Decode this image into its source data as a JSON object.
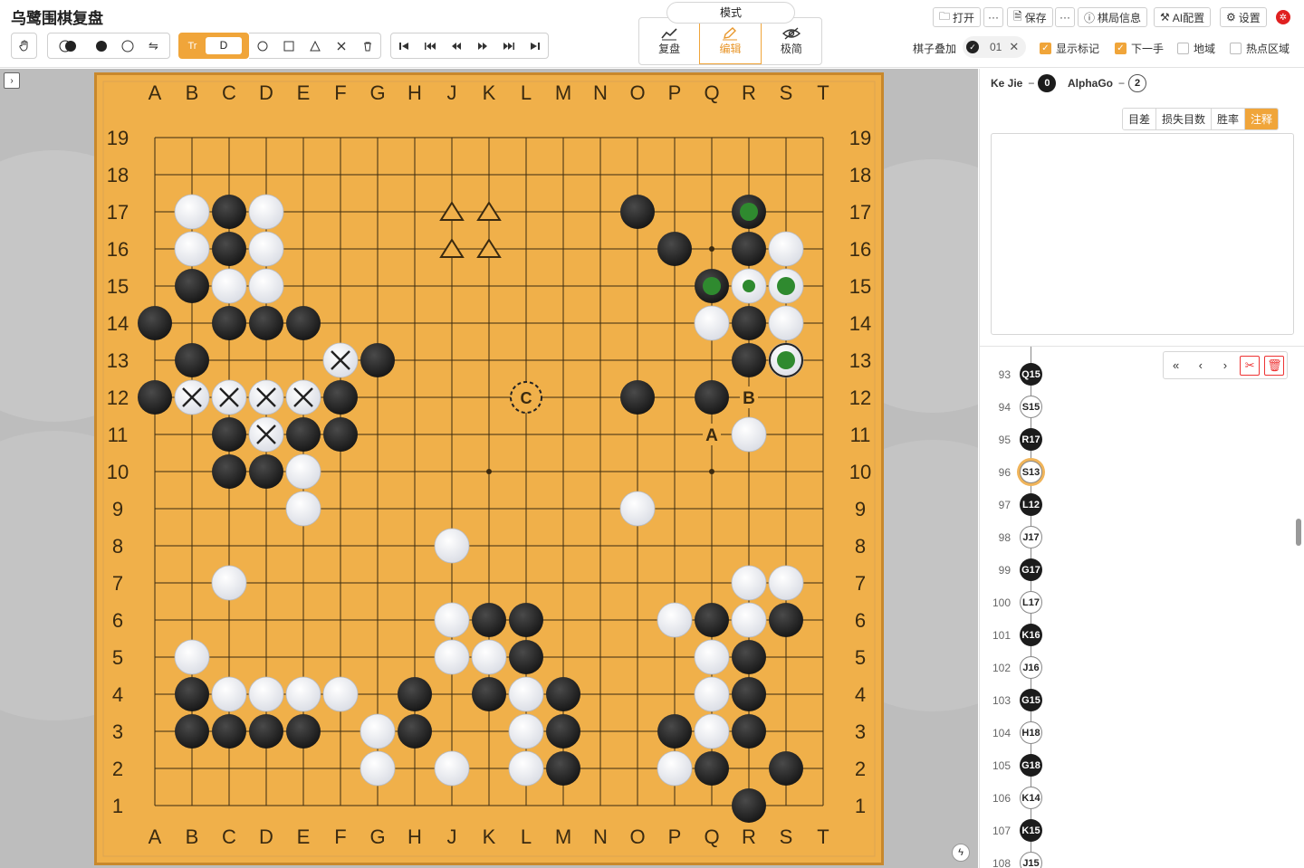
{
  "app_title": "乌鹭围棋复盘",
  "toolbar": {
    "text_input_value": "D",
    "text_tool_icon": "Tr"
  },
  "mode": {
    "title": "模式",
    "items": [
      {
        "label": "复盘"
      },
      {
        "label": "编辑"
      },
      {
        "label": "极简"
      }
    ],
    "active": "编辑"
  },
  "top_right": {
    "open": "打开",
    "save": "保存",
    "more": "···",
    "game_info": "棋局信息",
    "ai_config": "AI配置",
    "settings": "设置"
  },
  "overlay": {
    "label": "棋子叠加",
    "value": "01"
  },
  "checkboxes": [
    {
      "label": "显示标记",
      "checked": true
    },
    {
      "label": "下一手",
      "checked": true
    },
    {
      "label": "地域",
      "checked": false
    },
    {
      "label": "热点区域",
      "checked": false
    }
  ],
  "players": {
    "black": {
      "name": "Ke Jie",
      "captures": "0"
    },
    "white": {
      "name": "AlphaGo",
      "captures": "2"
    }
  },
  "analysis_tabs": [
    "目差",
    "损失目数",
    "胜率",
    "注释"
  ],
  "analysis_active": "注释",
  "board": {
    "size": 19,
    "col_labels": [
      "A",
      "B",
      "C",
      "D",
      "E",
      "F",
      "G",
      "H",
      "J",
      "K",
      "L",
      "M",
      "N",
      "O",
      "P",
      "Q",
      "R",
      "S",
      "T"
    ],
    "row_labels": [
      "19",
      "18",
      "17",
      "16",
      "15",
      "14",
      "13",
      "12",
      "11",
      "10",
      "9",
      "8",
      "7",
      "6",
      "5",
      "4",
      "3",
      "2",
      "1"
    ],
    "black_stones": [
      "C17",
      "O17",
      "R17",
      "C16",
      "P16",
      "R16",
      "B15",
      "Q15",
      "A14",
      "C14",
      "D14",
      "E14",
      "R14",
      "B13",
      "G13",
      "R13",
      "A12",
      "F12",
      "O12",
      "Q12",
      "C11",
      "E11",
      "F11",
      "C10",
      "D10",
      "K6",
      "L6",
      "Q6",
      "S6",
      "L5",
      "R5",
      "B4",
      "H4",
      "K4",
      "M4",
      "R4",
      "B3",
      "C3",
      "D3",
      "E3",
      "H3",
      "M3",
      "P3",
      "R3",
      "M2",
      "Q2",
      "S2",
      "R1"
    ],
    "white_stones": [
      "B17",
      "D17",
      "B16",
      "D16",
      "S16",
      "C15",
      "D15",
      "R15",
      "S15",
      "Q14",
      "S14",
      "S13",
      "F13",
      "B12",
      "C12",
      "D12",
      "E12",
      "D11",
      "R11",
      "E10",
      "E9",
      "O9",
      "J8",
      "C7",
      "R7",
      "S7",
      "J6",
      "P6",
      "R6",
      "B5",
      "J5",
      "K5",
      "Q5",
      "C4",
      "D4",
      "E4",
      "F4",
      "L4",
      "Q4",
      "G3",
      "L3",
      "Q3",
      "G2",
      "J2",
      "L2",
      "P2"
    ],
    "cross_marks": [
      "F13",
      "B12",
      "C12",
      "D12",
      "E12",
      "D11"
    ],
    "triangle_marks": [
      "J17",
      "K17",
      "J16",
      "K16"
    ],
    "green_dots": [
      "R17",
      "Q15",
      "R15",
      "S15",
      "S13"
    ],
    "circle_mark": "L12",
    "circle_label": "C",
    "current_move": "S13",
    "letter_marks": [
      {
        "pos": "Q11",
        "text": "A"
      },
      {
        "pos": "R12",
        "text": "B"
      }
    ],
    "colors": {
      "board": "#f0b04a",
      "line": "#3a2a10",
      "green": "#2f8a2f"
    }
  },
  "moves": [
    {
      "num": "93",
      "coord": "Q15",
      "color": "black"
    },
    {
      "num": "94",
      "coord": "S15",
      "color": "white"
    },
    {
      "num": "95",
      "coord": "R17",
      "color": "black"
    },
    {
      "num": "96",
      "coord": "S13",
      "color": "white",
      "current": true
    },
    {
      "num": "97",
      "coord": "L12",
      "color": "black"
    },
    {
      "num": "98",
      "coord": "J17",
      "color": "white"
    },
    {
      "num": "99",
      "coord": "G17",
      "color": "black"
    },
    {
      "num": "100",
      "coord": "L17",
      "color": "white"
    },
    {
      "num": "101",
      "coord": "K16",
      "color": "black"
    },
    {
      "num": "102",
      "coord": "J16",
      "color": "white"
    },
    {
      "num": "103",
      "coord": "G15",
      "color": "black"
    },
    {
      "num": "104",
      "coord": "H18",
      "color": "white"
    },
    {
      "num": "105",
      "coord": "G18",
      "color": "black"
    },
    {
      "num": "106",
      "coord": "K14",
      "color": "white"
    },
    {
      "num": "107",
      "coord": "K15",
      "color": "black"
    },
    {
      "num": "108",
      "coord": "J15",
      "color": "white"
    }
  ]
}
